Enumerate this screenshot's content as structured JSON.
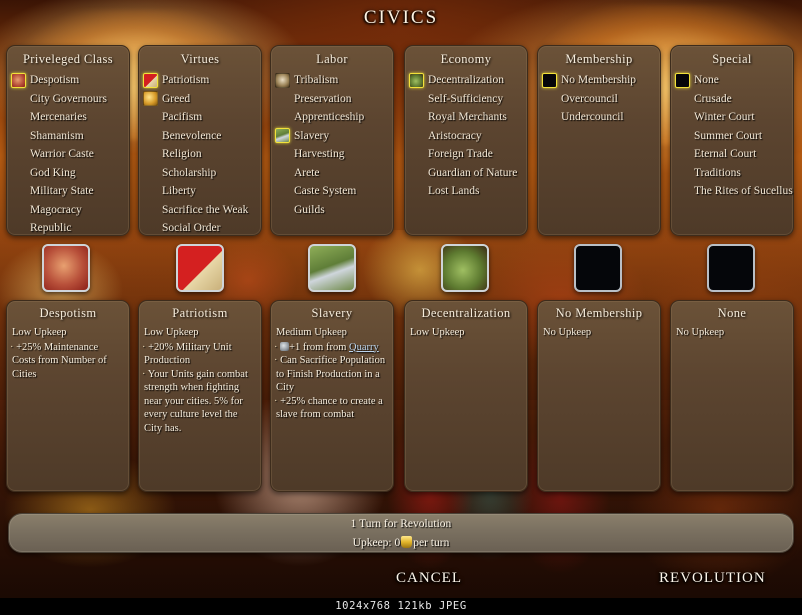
{
  "title": "CIVICS",
  "columns": [
    {
      "category": "Priveleged Class",
      "options": [
        {
          "label": "Despotism",
          "icon": "fist-icon",
          "state": "selected"
        },
        {
          "label": "City Governours",
          "icon": "none",
          "state": "none"
        },
        {
          "label": "Mercenaries",
          "icon": "none",
          "state": "none"
        },
        {
          "label": "Shamanism",
          "icon": "none",
          "state": "none"
        },
        {
          "label": "Warrior Caste",
          "icon": "none",
          "state": "none"
        },
        {
          "label": "God King",
          "icon": "none",
          "state": "none"
        },
        {
          "label": "Military State",
          "icon": "none",
          "state": "none"
        },
        {
          "label": "Magocracy",
          "icon": "none",
          "state": "none"
        },
        {
          "label": "Republic",
          "icon": "none",
          "state": "none"
        }
      ]
    },
    {
      "category": "Virtues",
      "options": [
        {
          "label": "Patriotism",
          "icon": "flag-icon",
          "state": "selected"
        },
        {
          "label": "Greed",
          "icon": "gold-icon",
          "state": "available"
        },
        {
          "label": "Pacifism",
          "icon": "none",
          "state": "none"
        },
        {
          "label": "Benevolence",
          "icon": "none",
          "state": "none"
        },
        {
          "label": "Religion",
          "icon": "none",
          "state": "none"
        },
        {
          "label": "Scholarship",
          "icon": "none",
          "state": "none"
        },
        {
          "label": "Liberty",
          "icon": "none",
          "state": "none"
        },
        {
          "label": "Sacrifice the Weak",
          "icon": "none",
          "state": "none"
        },
        {
          "label": "Social Order",
          "icon": "none",
          "state": "none"
        }
      ]
    },
    {
      "category": "Labor",
      "options": [
        {
          "label": "Tribalism",
          "icon": "tribe-icon",
          "state": "available"
        },
        {
          "label": "Preservation",
          "icon": "none",
          "state": "none"
        },
        {
          "label": "Apprenticeship",
          "icon": "none",
          "state": "none"
        },
        {
          "label": "Slavery",
          "icon": "chain-icon",
          "state": "selected"
        },
        {
          "label": "Harvesting",
          "icon": "none",
          "state": "none"
        },
        {
          "label": "Arete",
          "icon": "none",
          "state": "none"
        },
        {
          "label": "Caste System",
          "icon": "none",
          "state": "none"
        },
        {
          "label": "Guilds",
          "icon": "none",
          "state": "none"
        }
      ]
    },
    {
      "category": "Economy",
      "options": [
        {
          "label": "Decentralization",
          "icon": "coin-icon",
          "state": "selected"
        },
        {
          "label": "Self-Sufficiency",
          "icon": "none",
          "state": "none"
        },
        {
          "label": "Royal Merchants",
          "icon": "none",
          "state": "none"
        },
        {
          "label": "Aristocracy",
          "icon": "none",
          "state": "none"
        },
        {
          "label": "Foreign Trade",
          "icon": "none",
          "state": "none"
        },
        {
          "label": "Guardian of Nature",
          "icon": "none",
          "state": "none"
        },
        {
          "label": "Lost Lands",
          "icon": "none",
          "state": "none"
        }
      ]
    },
    {
      "category": "Membership",
      "options": [
        {
          "label": "No Membership",
          "icon": "blank-icon",
          "state": "selected"
        },
        {
          "label": "Overcouncil",
          "icon": "none",
          "state": "none"
        },
        {
          "label": "Undercouncil",
          "icon": "none",
          "state": "none"
        }
      ]
    },
    {
      "category": "Special",
      "options": [
        {
          "label": "None",
          "icon": "blank-icon",
          "state": "selected"
        },
        {
          "label": "Crusade",
          "icon": "none",
          "state": "none"
        },
        {
          "label": "Winter Court",
          "icon": "none",
          "state": "none"
        },
        {
          "label": "Summer Court",
          "icon": "none",
          "state": "none"
        },
        {
          "label": "Eternal Court",
          "icon": "none",
          "state": "none"
        },
        {
          "label": "Traditions",
          "icon": "none",
          "state": "none"
        },
        {
          "label": "The Rites of Sucellus",
          "icon": "none",
          "state": "none"
        }
      ]
    }
  ],
  "selected_icons": [
    {
      "name": "despotism-icon",
      "art": "ic-fist"
    },
    {
      "name": "patriotism-icon",
      "art": "ic-flag"
    },
    {
      "name": "slavery-icon",
      "art": "ic-chain"
    },
    {
      "name": "decentralization-icon",
      "art": "ic-coin"
    },
    {
      "name": "no-membership-icon",
      "art": "ic-black"
    },
    {
      "name": "special-none-icon",
      "art": "ic-black"
    }
  ],
  "details": [
    {
      "title": "Despotism",
      "upkeep": "Low Upkeep",
      "effects": [
        "+25% Maintenance Costs from Number of Cities"
      ]
    },
    {
      "title": "Patriotism",
      "upkeep": "Low Upkeep",
      "effects": [
        "+20% Military Unit Production",
        "Your Units gain combat strength when fighting near your cities. 5% for every culture level the City has."
      ]
    },
    {
      "title": "Slavery",
      "upkeep": "Medium Upkeep",
      "effects": [
        "+1 ▪ from Quarry",
        "Can Sacrifice Population to Finish Production in a City",
        "+25% chance to create a slave from combat"
      ],
      "link_text": "Quarry"
    },
    {
      "title": "Decentralization",
      "upkeep": "Low Upkeep",
      "effects": []
    },
    {
      "title": "No Membership",
      "upkeep": "No Upkeep",
      "effects": []
    },
    {
      "title": "None",
      "upkeep": "No Upkeep",
      "effects": []
    }
  ],
  "status": {
    "revolution_turns": "1 Turn for Revolution",
    "upkeep_prefix": "Upkeep: 0",
    "upkeep_suffix": "per turn"
  },
  "buttons": {
    "cancel": "CANCEL",
    "revolution": "REVOLUTION"
  },
  "info_strip": "1024x768  121kb  JPEG",
  "colors": {
    "panel_bg": "#5c4530",
    "panel_border": "#3d2c1c",
    "text": "#f2e7d5",
    "selection_highlight": "#f2e23a",
    "link": "#bcd4ec",
    "status_bar": "#7a7060"
  }
}
